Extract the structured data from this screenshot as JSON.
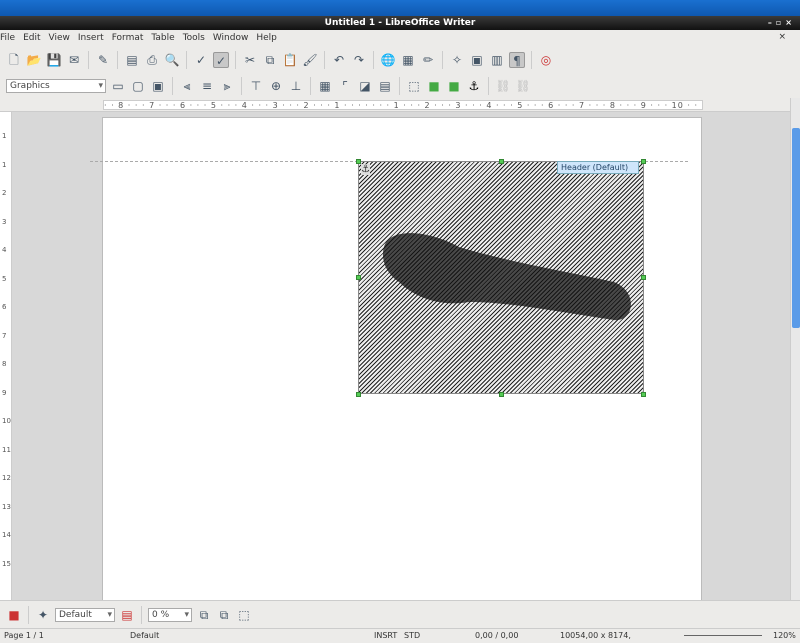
{
  "window": {
    "title": "Untitled 1 - LibreOffice Writer"
  },
  "menu": [
    "File",
    "Edit",
    "View",
    "Insert",
    "Format",
    "Table",
    "Tools",
    "Window",
    "Help"
  ],
  "frame_style": {
    "value": "Graphics"
  },
  "ruler": {
    "horizontal": "· · 8 · · · 7 · · · 6 · · · 5 · · · 4 · · · 3 · · · 2 · · · 1 · · · · · · · 1 · · · 2 · · · 3 · · · 4 · · · 5 · · · 6 · · · 7 · · · 8 · · · 9 · · · 10 · · 11 · ·",
    "vertical": [
      "1",
      "1",
      "2",
      "3",
      "4",
      "5",
      "6",
      "7",
      "8",
      "9",
      "10",
      "11",
      "12",
      "13",
      "14",
      "15"
    ]
  },
  "header_tag": "Header (Default)",
  "image_toolbar": {
    "filter_value": "Default",
    "transparency": "0 %"
  },
  "status": {
    "page": "Page 1 / 1",
    "style": "Default",
    "mode": "INSRT",
    "selection": "STD",
    "position": "0,00 / 0,00",
    "size": "10054,00 x 8174,",
    "zoom": "120%"
  },
  "zoom_level": 120
}
